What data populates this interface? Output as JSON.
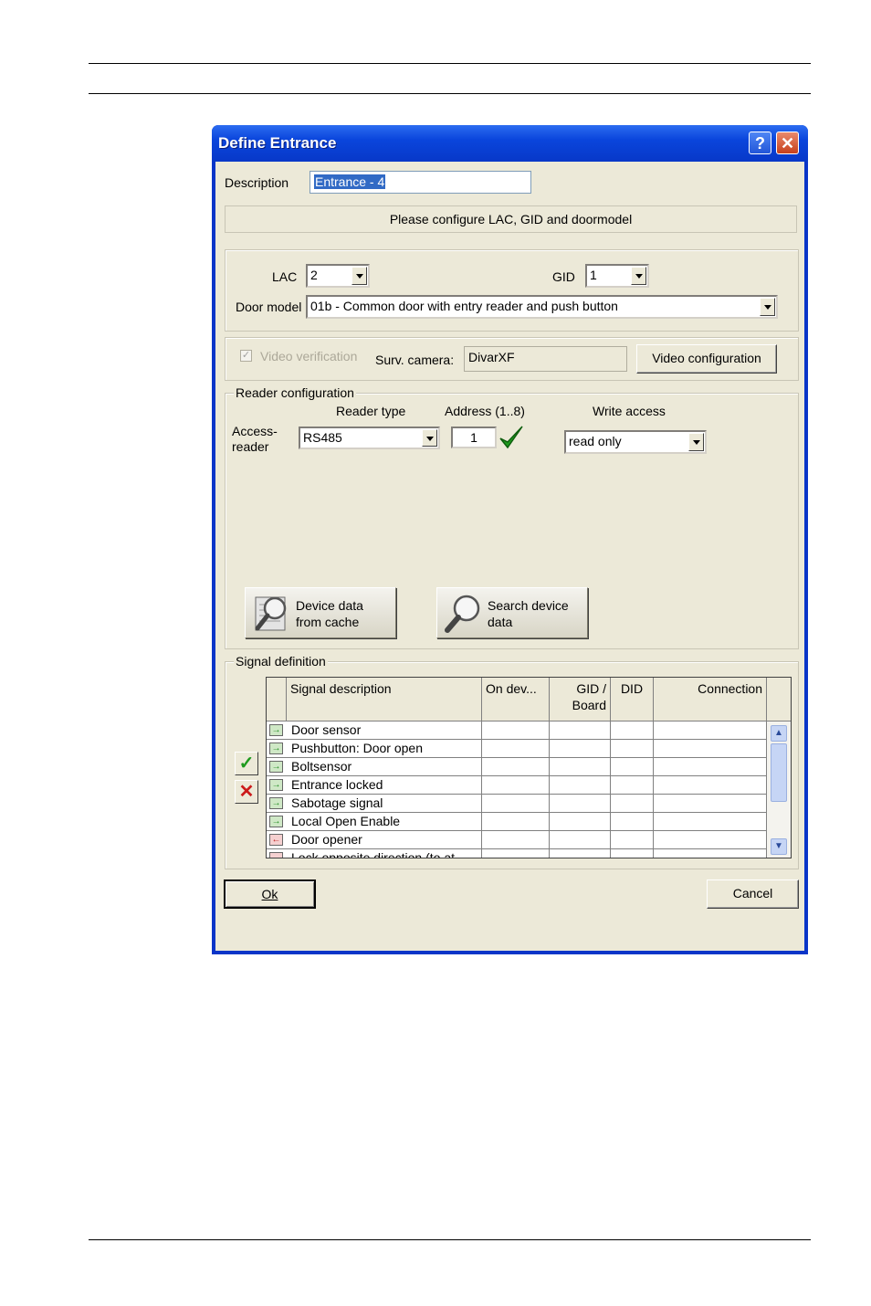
{
  "window": {
    "title": "Define Entrance",
    "help_glyph": "?",
    "close_glyph": "✕"
  },
  "description": {
    "label": "Description",
    "value": "Entrance - 4"
  },
  "status_message": "Please configure LAC, GID and doormodel",
  "lac": {
    "label": "LAC",
    "value": "2"
  },
  "gid": {
    "label": "GID",
    "value": "1"
  },
  "door_model": {
    "label": "Door model",
    "value": "01b - Common door with entry reader and push button"
  },
  "video": {
    "checkbox_label": "Video verification",
    "checked": true,
    "camera_label": "Surv. camera:",
    "camera_value": "DivarXF",
    "config_button": "Video configuration"
  },
  "reader_config": {
    "title": "Reader configuration",
    "col_reader_type": "Reader type",
    "col_address": "Address (1..8)",
    "col_write_access": "Write access",
    "row_label_line1": "Access-",
    "row_label_line2": "reader",
    "reader_type": "RS485",
    "address": "1",
    "write_access": "read only",
    "btn_cache_line1": "Device data",
    "btn_cache_line2": "from cache",
    "btn_search_line1": "Search device",
    "btn_search_line2": "data"
  },
  "signal_definition": {
    "title": "Signal definition",
    "headers": {
      "description": "Signal description",
      "on_device": "On dev...",
      "gid_board_line1": "GID /",
      "gid_board_line2": "Board",
      "did": "DID",
      "connection": "Connection"
    },
    "rows": [
      {
        "direction": "in",
        "description": "Door sensor"
      },
      {
        "direction": "in",
        "description": "Pushbutton: Door open"
      },
      {
        "direction": "in",
        "description": "Boltsensor"
      },
      {
        "direction": "in",
        "description": "Entrance locked"
      },
      {
        "direction": "in",
        "description": "Sabotage signal"
      },
      {
        "direction": "in",
        "description": "Local Open Enable"
      },
      {
        "direction": "out",
        "description": "Door opener"
      },
      {
        "direction": "out",
        "description": "Lock opposite direction (to at..."
      }
    ]
  },
  "buttons": {
    "ok": "Ok",
    "cancel": "Cancel"
  },
  "colors": {
    "titlebar": "#0a45dc",
    "dialog_bg": "#ece9d8",
    "check_green": "#1e9a1e",
    "delete_red": "#cc1a1a"
  }
}
